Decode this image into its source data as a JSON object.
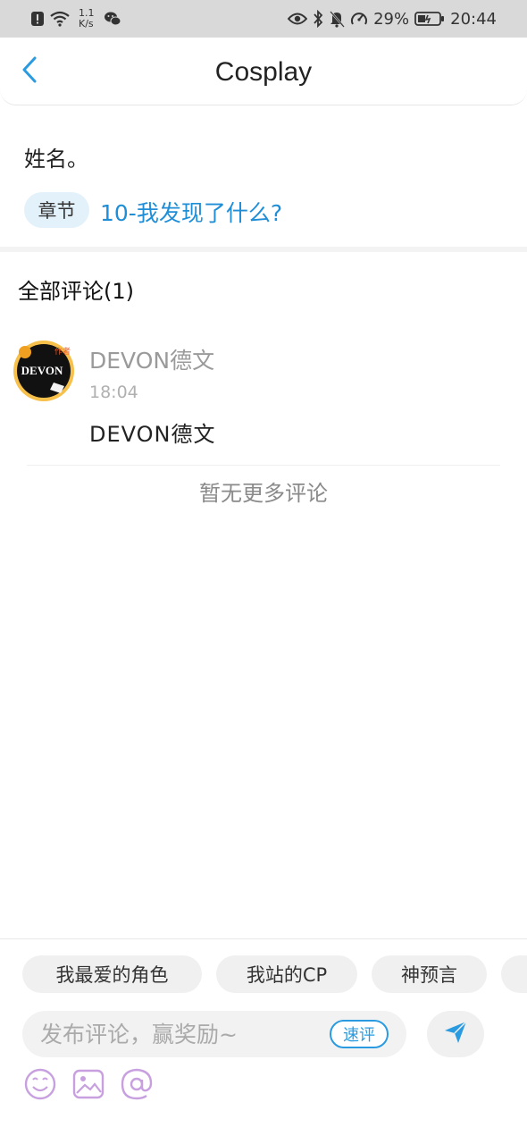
{
  "status_bar": {
    "speed_value": "1.1",
    "speed_unit": "K/s",
    "battery_percent": "29%",
    "time": "20:44"
  },
  "header": {
    "title": "Cosplay",
    "back_icon": "chevron-left-icon"
  },
  "post": {
    "name": "姓名。",
    "chapter_badge": "章节",
    "chapter_title": "10-我发现了什么?"
  },
  "comments": {
    "heading": "全部评论(1)",
    "items": [
      {
        "username": "DEVON德文",
        "time": "18:04",
        "body": "DEVON德文",
        "avatar_text": "DEVON",
        "avatar_tag": "作者"
      }
    ],
    "no_more": "暂无更多评论"
  },
  "composer": {
    "chips": [
      "我最爱的角色",
      "我站的CP",
      "神预言"
    ],
    "placeholder": "发布评论，赢奖励~",
    "quick_label": "速评",
    "send_icon": "send-icon",
    "tools": [
      "emoji-icon",
      "image-icon",
      "at-icon"
    ]
  },
  "colors": {
    "accent": "#1f8ed6",
    "chip_bg": "#f0f0f0",
    "tool_icon": "#c8a0e0"
  }
}
